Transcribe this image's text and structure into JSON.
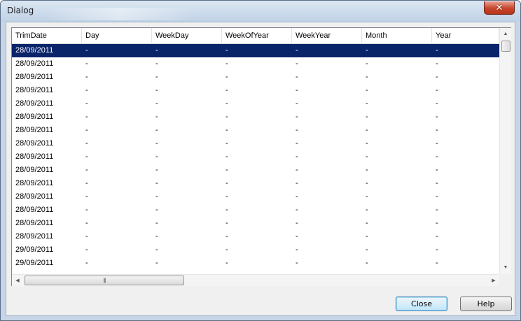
{
  "window": {
    "title": "Dialog",
    "close_glyph": "✕"
  },
  "grid": {
    "columns": [
      "TrimDate",
      "Day",
      "WeekDay",
      "WeekOfYear",
      "WeekYear",
      "Month",
      "Year"
    ],
    "rows": [
      [
        "28/09/2011",
        "-",
        "-",
        "-",
        "-",
        "-",
        "-"
      ],
      [
        "28/09/2011",
        "-",
        "-",
        "-",
        "-",
        "-",
        "-"
      ],
      [
        "28/09/2011",
        "-",
        "-",
        "-",
        "-",
        "-",
        "-"
      ],
      [
        "28/09/2011",
        "-",
        "-",
        "-",
        "-",
        "-",
        "-"
      ],
      [
        "28/09/2011",
        "-",
        "-",
        "-",
        "-",
        "-",
        "-"
      ],
      [
        "28/09/2011",
        "-",
        "-",
        "-",
        "-",
        "-",
        "-"
      ],
      [
        "28/09/2011",
        "-",
        "-",
        "-",
        "-",
        "-",
        "-"
      ],
      [
        "28/09/2011",
        "-",
        "-",
        "-",
        "-",
        "-",
        "-"
      ],
      [
        "28/09/2011",
        "-",
        "-",
        "-",
        "-",
        "-",
        "-"
      ],
      [
        "28/09/2011",
        "-",
        "-",
        "-",
        "-",
        "-",
        "-"
      ],
      [
        "28/09/2011",
        "-",
        "-",
        "-",
        "-",
        "-",
        "-"
      ],
      [
        "28/09/2011",
        "-",
        "-",
        "-",
        "-",
        "-",
        "-"
      ],
      [
        "28/09/2011",
        "-",
        "-",
        "-",
        "-",
        "-",
        "-"
      ],
      [
        "28/09/2011",
        "-",
        "-",
        "-",
        "-",
        "-",
        "-"
      ],
      [
        "28/09/2011",
        "-",
        "-",
        "-",
        "-",
        "-",
        "-"
      ],
      [
        "29/09/2011",
        "-",
        "-",
        "-",
        "-",
        "-",
        "-"
      ],
      [
        "29/09/2011",
        "-",
        "-",
        "-",
        "-",
        "-",
        "-"
      ]
    ],
    "selected_row": 0,
    "selection_color": "#0a246a",
    "vscroll_up_glyph": "▲",
    "vscroll_down_glyph": "▼",
    "hscroll_left_glyph": "◀",
    "hscroll_right_glyph": "▶",
    "hscroll_grip": "|||"
  },
  "buttons": {
    "close_label": "Close",
    "help_label": "Help"
  },
  "icons": {
    "close": "close-icon",
    "scroll_up": "chevron-up-icon",
    "scroll_down": "chevron-down-icon",
    "scroll_left": "chevron-left-icon",
    "scroll_right": "chevron-right-icon"
  }
}
